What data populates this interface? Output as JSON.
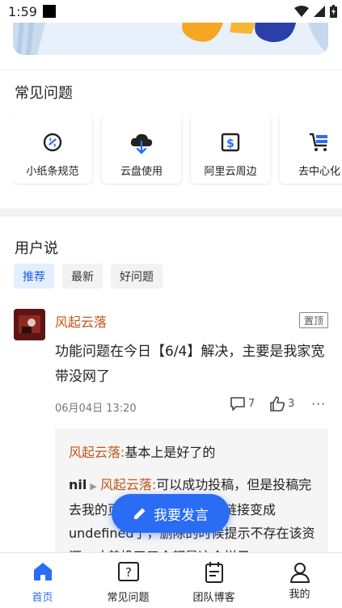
{
  "status_bar": {
    "time": "1:59"
  },
  "faq": {
    "title": "常见问题",
    "items": [
      {
        "label": "小纸条规范",
        "icon": "note-link-icon"
      },
      {
        "label": "云盘使用",
        "icon": "cloud-download-icon"
      },
      {
        "label": "阿里云周边",
        "icon": "dollar-box-icon"
      },
      {
        "label": "去中心化",
        "icon": "cart-icon"
      }
    ]
  },
  "user_says": {
    "title": "用户说",
    "tabs": [
      "推荐",
      "最新",
      "好问题"
    ],
    "active_tab": "推荐"
  },
  "post": {
    "author": "风起云落",
    "pinned_label": "置顶",
    "content": "功能问题在今日【6/4】解决，主要是我家宽带没网了",
    "date": "06月04日 13:20",
    "comments": "7",
    "likes": "3",
    "replies": [
      {
        "user": "风起云落:",
        "text": "基本上是好了的"
      },
      {
        "user": "nil",
        "reply_to": "风起云落:",
        "text": "可以成功投稿，但是投稿完去我的页面查看，我的云盘链接变成undefined了，删除的时候提示不存在该资源，才差投了三个都是这个样子"
      }
    ]
  },
  "fab": {
    "label": "我要发言"
  },
  "bottom_nav": [
    {
      "label": "首页",
      "icon": "home-icon",
      "active": true
    },
    {
      "label": "常见问题",
      "icon": "question-icon",
      "active": false
    },
    {
      "label": "团队博客",
      "icon": "calendar-note-icon",
      "active": false
    },
    {
      "label": "我的",
      "icon": "person-icon",
      "active": false
    }
  ],
  "colors": {
    "accent": "#2a6df4",
    "author": "#c0551a"
  }
}
